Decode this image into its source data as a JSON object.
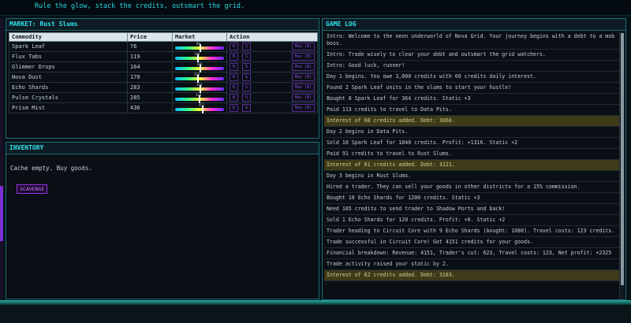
{
  "topbar": {
    "text": "Rule the glow, stack the credits, outsmart the grid."
  },
  "market": {
    "title": "MARKET: Rust Slums",
    "headers": [
      "Commodity",
      "Price",
      "Market",
      "Action"
    ],
    "rows": [
      {
        "commodity": "Spark Leaf",
        "price": "76",
        "level": 0.5,
        "tick": "88"
      },
      {
        "commodity": "Flux Tabs",
        "price": "119",
        "level": 0.45,
        "tick": "140"
      },
      {
        "commodity": "Glimmer Drops",
        "price": "164",
        "level": 0.5,
        "tick": "186"
      },
      {
        "commodity": "Nova Dust",
        "price": "170",
        "level": 0.45,
        "tick": "208"
      },
      {
        "commodity": "Echo Shards",
        "price": "283",
        "level": 0.5,
        "tick": "318"
      },
      {
        "commodity": "Pulse Crystals",
        "price": "285",
        "level": 0.48,
        "tick": "318"
      },
      {
        "commodity": "Prism Mist",
        "price": "436",
        "level": 0.55,
        "tick": "452"
      }
    ],
    "action": {
      "buy": "B",
      "sell": "S",
      "max": "Max (B)"
    }
  },
  "inventory": {
    "title": "INVENTORY",
    "empty_text": "Cache empty. Buy goods.",
    "scavenge_label": "SCAVENGE"
  },
  "gamelog": {
    "title": "GAME LOG",
    "entries": [
      {
        "t": "Intro: Welcome to the neon underworld of Nova Grid. Your journey begins with a debt to a mob boss."
      },
      {
        "t": "Intro: Trade wisely to clear your debt and outsmart the grid watchers."
      },
      {
        "t": "Intro: Good luck, runner!"
      },
      {
        "t": "Day 1 begins. You owe 3,000 credits with 60 credits daily interest."
      },
      {
        "t": "Found 2 Spark Leaf units in the slums to start your hustle!"
      },
      {
        "t": "Bought 8 Spark Leaf for 364 credits. Static +3"
      },
      {
        "t": "Paid 113 credits to travel to Data Pits."
      },
      {
        "t": "Interest of 60 credits added. Debt: 3060.",
        "interest": true
      },
      {
        "t": "Day 2 begins in Data Pits."
      },
      {
        "t": "Sold 10 Spark Leaf for 1840 credits. Profit: +1316. Static +2"
      },
      {
        "t": "Paid 91 credits to travel to Rust Slums."
      },
      {
        "t": "Interest of 61 credits added. Debt: 3121.",
        "interest": true
      },
      {
        "t": "Day 3 begins in Rust Slums."
      },
      {
        "t": "Hired a trader. They can sell your goods in other districts for a 15% commission."
      },
      {
        "t": "Bought 10 Echo Shards for 1200 credits. Static +3"
      },
      {
        "t": "Need 165 credits to send trader to Shadow Ports and back!"
      },
      {
        "t": "Sold 1 Echo Shards for 120 credits. Profit: +0. Static +2"
      },
      {
        "t": "Trader heading to Circuit Core with 9 Echo Shards (bought: 1080). Travel costs: 123 credits."
      },
      {
        "t": "Trade successful in Circuit Core! Got 4151 credits for your goods."
      },
      {
        "t": "Financial breakdown: Revenue: 4151, Trader's cut: 623, Travel costs: 123, Net profit: +2325"
      },
      {
        "t": "Trade activity raised your static by 2."
      },
      {
        "t": "Interest of 62 credits added. Debt: 3183.",
        "interest": true
      }
    ]
  }
}
